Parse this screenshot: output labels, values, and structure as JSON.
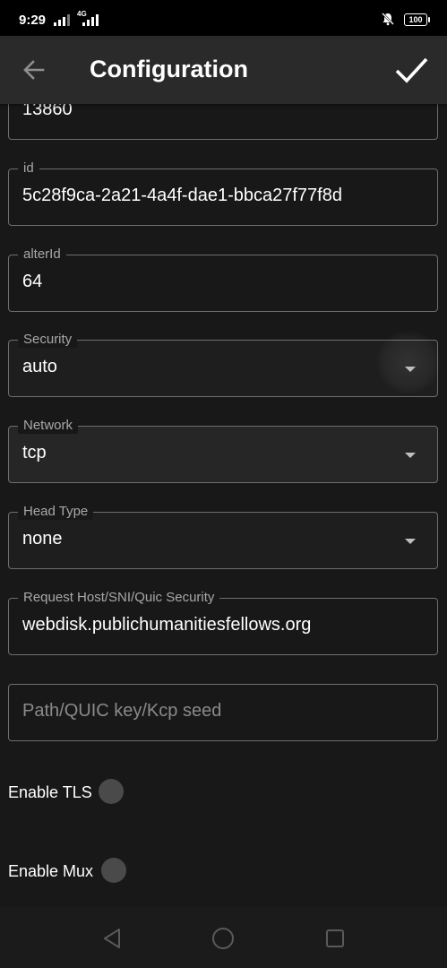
{
  "status_bar": {
    "time": "9:29",
    "network_label": "4G",
    "battery": "100"
  },
  "app_bar": {
    "title": "Configuration",
    "back_icon": "arrow-back-icon",
    "save_icon": "check-icon"
  },
  "fields": {
    "port": {
      "value": "13860"
    },
    "id": {
      "label": "id",
      "value": "5c28f9ca-2a21-4a4f-dae1-bbca27f77f8d"
    },
    "alter_id": {
      "label": "alterId",
      "value": "64"
    },
    "security": {
      "label": "Security",
      "value": "auto"
    },
    "network": {
      "label": "Network",
      "value": "tcp"
    },
    "head_type": {
      "label": "Head Type",
      "value": "none"
    },
    "request_host": {
      "label": "Request Host/SNI/Quic Security",
      "value": "webdisk.publichumanitiesfellows.org"
    },
    "path": {
      "placeholder": "Path/QUIC key/Kcp seed",
      "value": ""
    }
  },
  "toggles": {
    "tls": {
      "label": "Enable TLS",
      "enabled": false
    },
    "mux": {
      "label": "Enable Mux",
      "enabled": false
    }
  },
  "colors": {
    "background": "#181818",
    "app_bar": "#2a2a2a",
    "outline": "#6e6e6e",
    "label": "#a8a8a8",
    "toggle_off": "#4a4a4a"
  }
}
